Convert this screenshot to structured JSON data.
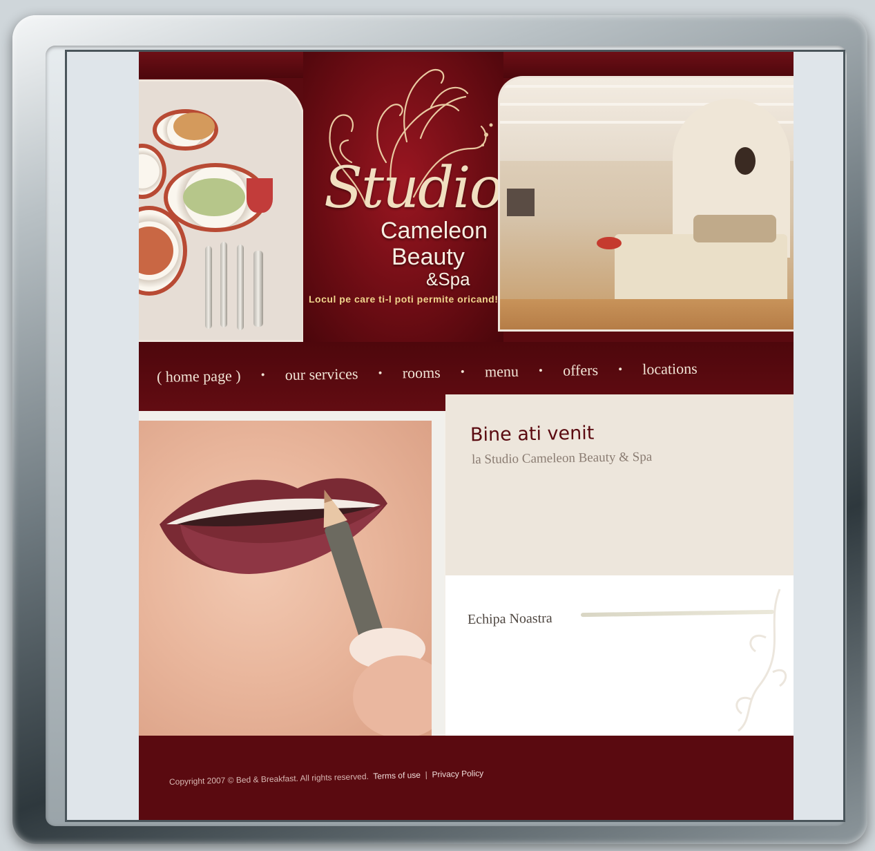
{
  "logo": {
    "line1": "Studio",
    "line2": "Cameleon",
    "line3": "Beauty",
    "line4": "&Spa",
    "tagline": "Locul pe care ti-l poti permite oricand!"
  },
  "nav": {
    "items": [
      {
        "label": "( home page )"
      },
      {
        "label": "our services"
      },
      {
        "label": "rooms"
      },
      {
        "label": "menu"
      },
      {
        "label": "offers"
      },
      {
        "label": "locations"
      }
    ],
    "separator": "•"
  },
  "welcome": {
    "title": "Bine ati venit",
    "subtitle": "la Studio Cameleon Beauty & Spa"
  },
  "team": {
    "title": "Echipa Noastra"
  },
  "footer": {
    "copyright": "Copyright 2007 © Bed & Breakfast. All rights reserved.",
    "terms": "Terms of use",
    "divider": "|",
    "privacy": "Privacy Policy"
  },
  "colors": {
    "brand": "#5a0a10",
    "logo_gold": "#f1dfc0",
    "nav_text": "#f1e4d5",
    "panel_bg": "#ede6dc"
  }
}
